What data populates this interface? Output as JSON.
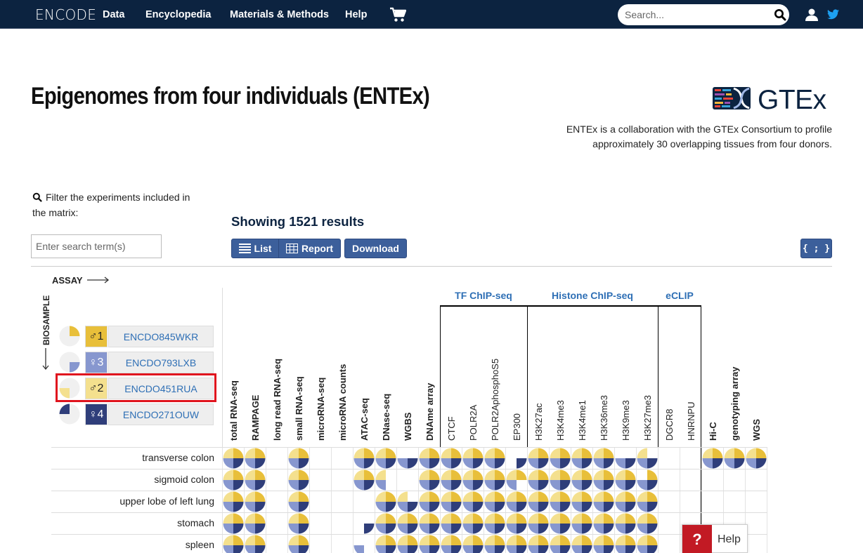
{
  "nav": {
    "brand": "ENCODE",
    "items": [
      "Data",
      "Encyclopedia",
      "Materials & Methods",
      "Help"
    ],
    "search_placeholder": "Search..."
  },
  "header": {
    "title": "Epigenomes from four individuals (ENTEx)",
    "logo_text": "GTEx",
    "description": "ENTEx is a collaboration with the GTEx Consortium to profile approximately 30 overlapping tissues from four donors."
  },
  "filter": {
    "label": "Filter the experiments included in the matrix:",
    "placeholder": "Enter search term(s)"
  },
  "results": "Showing 1521 results",
  "buttons": {
    "list": "List",
    "report": "Report",
    "download": "Download",
    "json": "{ ; }"
  },
  "matrix": {
    "assay_label": "ASSAY",
    "biosample_label": "BIOSAMPLE",
    "donors": [
      {
        "sex": "♂1",
        "id": "ENCDO845WKR",
        "color": "#e8bf3a"
      },
      {
        "sex": "♀3",
        "id": "ENCDO793LXB",
        "color": "#8797cf"
      },
      {
        "sex": "♂2",
        "id": "ENCDO451RUA",
        "color": "#f4e08e"
      },
      {
        "sex": "♀4",
        "id": "ENCDO271OUW",
        "color": "#2f3e7a"
      }
    ],
    "groups": [
      "TF ChIP-seq",
      "Histone ChIP-seq",
      "eCLIP"
    ],
    "columns": [
      "total RNA-seq",
      "RAMPAGE",
      "long read RNA-seq",
      "small RNA-seq",
      "microRNA-seq",
      "microRNA counts",
      "ATAC-seq",
      "DNase-seq",
      "WGBS",
      "DNAme array",
      "CTCF",
      "POLR2A",
      "POLR2AphosphoS5",
      "EP300",
      "H3K27ac",
      "H3K4me3",
      "H3K4me1",
      "H3K36me3",
      "H3K9me3",
      "H3K27me3",
      "DGCR8",
      "HNRNPU",
      "Hi-C",
      "genotyping array",
      "WGS"
    ],
    "rows": [
      "transverse colon",
      "sigmoid colon",
      "upper lobe of left lung",
      "stomach",
      "spleen"
    ],
    "cells": [
      [
        15,
        15,
        0,
        15,
        0,
        0,
        15,
        15,
        12,
        15,
        15,
        15,
        15,
        4,
        15,
        15,
        15,
        15,
        12,
        13,
        0,
        0,
        15,
        15,
        15
      ],
      [
        15,
        15,
        0,
        15,
        0,
        0,
        15,
        9,
        0,
        15,
        15,
        15,
        15,
        11,
        15,
        15,
        15,
        15,
        15,
        14,
        0,
        0,
        0,
        0,
        0
      ],
      [
        15,
        15,
        0,
        15,
        0,
        0,
        0,
        15,
        13,
        15,
        15,
        15,
        15,
        15,
        15,
        15,
        15,
        15,
        15,
        15,
        0,
        0,
        0,
        0,
        0
      ],
      [
        15,
        15,
        0,
        15,
        0,
        0,
        4,
        15,
        15,
        15,
        15,
        15,
        15,
        15,
        15,
        15,
        15,
        15,
        15,
        15,
        0,
        0,
        0,
        0,
        0
      ],
      [
        15,
        15,
        0,
        15,
        0,
        0,
        8,
        15,
        15,
        15,
        15,
        15,
        15,
        15,
        15,
        15,
        15,
        15,
        15,
        15,
        0,
        0,
        0,
        0,
        0
      ]
    ]
  },
  "help_button": "Help"
}
